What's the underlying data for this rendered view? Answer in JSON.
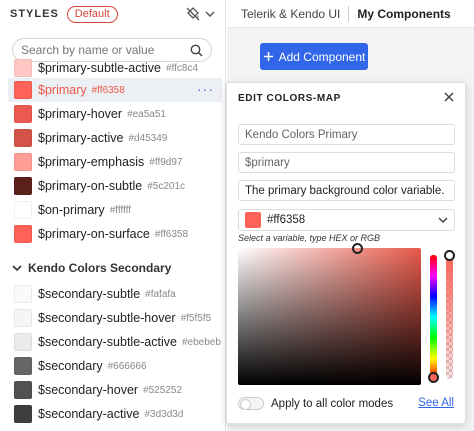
{
  "sidebar": {
    "title": "STYLES",
    "badge": "Default",
    "search_placeholder": "Search by name or value",
    "primary_items": [
      {
        "name": "$primary-subtle-active",
        "hex": "#ffc8c4",
        "color": "#ffc8c4"
      },
      {
        "name": "$primary",
        "hex": "#ff6358",
        "color": "#ff6358"
      },
      {
        "name": "$primary-hover",
        "hex": "#ea5a51",
        "color": "#ea5a51"
      },
      {
        "name": "$primary-active",
        "hex": "#d45349",
        "color": "#d45349"
      },
      {
        "name": "$primary-emphasis",
        "hex": "#ff9d97",
        "color": "#ff9d97"
      },
      {
        "name": "$primary-on-subtle",
        "hex": "#5c201c",
        "color": "#5c201c"
      },
      {
        "name": "$on-primary",
        "hex": "#ffffff",
        "color": "#ffffff"
      },
      {
        "name": "$primary-on-surface",
        "hex": "#ff6358",
        "color": "#ff6358"
      }
    ],
    "section_secondary": "Kendo Colors Secondary",
    "secondary_items": [
      {
        "name": "$secondary-subtle",
        "hex": "#fafafa",
        "color": "#fafafa"
      },
      {
        "name": "$secondary-subtle-hover",
        "hex": "#f5f5f5",
        "color": "#f5f5f5"
      },
      {
        "name": "$secondary-subtle-active",
        "hex": "#ebebeb",
        "color": "#ebebeb"
      },
      {
        "name": "$secondary",
        "hex": "#666666",
        "color": "#666666"
      },
      {
        "name": "$secondary-hover",
        "hex": "#525252",
        "color": "#525252"
      },
      {
        "name": "$secondary-active",
        "hex": "#3d3d3d",
        "color": "#3d3d3d"
      }
    ],
    "more_label": "···"
  },
  "header": {
    "breadcrumb_root": "Telerik & Kendo UI",
    "breadcrumb_current": "My Components"
  },
  "toolbar": {
    "add_label": "Add Component"
  },
  "popup": {
    "title": "EDIT COLORS-MAP",
    "group_value": "Kendo Colors Primary",
    "name_value": "$primary",
    "description_value": "The primary background color variable.",
    "color_value": "#ff6358",
    "hint": "Select a variable, type HEX or RGB",
    "apply_label": "Apply to all color modes",
    "apply_checked": false,
    "see_all": "See All"
  },
  "colors": {
    "accent": "#3166e8",
    "selected_color": "#ff6358",
    "badge": "#d6453b"
  }
}
